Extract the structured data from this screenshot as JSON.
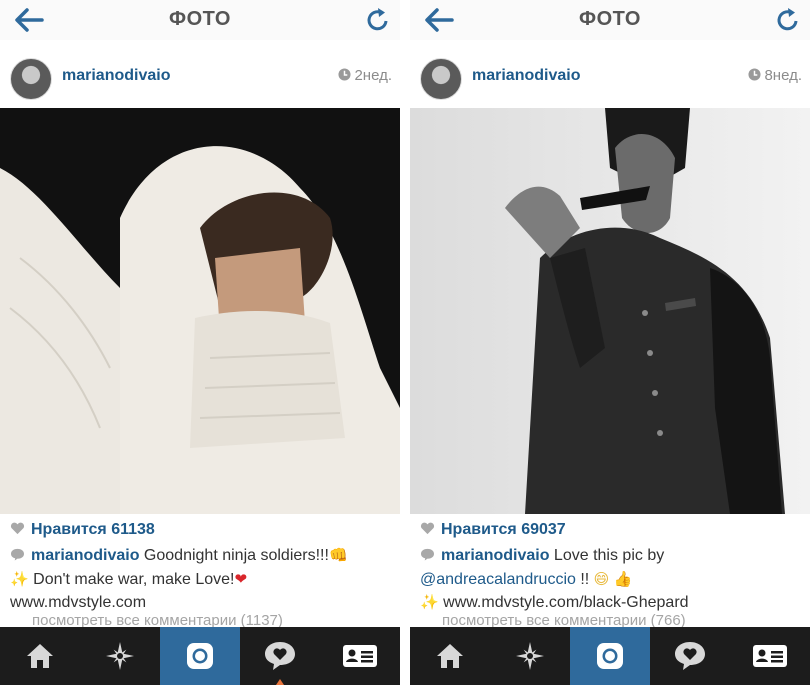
{
  "panels": [
    {
      "header": {
        "title": "ФОТО"
      },
      "post": {
        "username": "marianodivaio",
        "time": "2нед.",
        "likes": "Нравится 61138",
        "caption_user": "marianodivaio",
        "caption_text": " Goodnight ninja soldiers!!!",
        "caption_emoji_1": "👊",
        "caption_sparkle": "✨",
        "caption_text_2": " Don't make war, make Love!",
        "caption_emoji_2": "❤",
        "caption_link": "www.mdvstyle.com",
        "view_all_comments": "посмотреть все комментарии (1137)"
      }
    },
    {
      "header": {
        "title": "ФОТО"
      },
      "post": {
        "username": "marianodivaio",
        "time": "8нед.",
        "likes": "Нравится 69037",
        "caption_user": "marianodivaio",
        "caption_text": " Love this pic by",
        "caption_mention": "@andreacalandruccio",
        "caption_text_2": " !! ",
        "caption_emoji_1": "😄",
        "caption_emoji_2": "👍",
        "caption_sparkle": "✨",
        "caption_link": " www.mdvstyle.com/black-Ghepard",
        "view_all_comments": "посмотреть все комментарии (766)"
      }
    }
  ],
  "tabbar": {
    "tabs": [
      "home-icon",
      "explore-icon",
      "camera-icon",
      "activity-icon",
      "profile-icon"
    ],
    "active_index": 2
  },
  "colors": {
    "accent": "#1e5a8a",
    "tab_active": "#2f6a9c",
    "tabbar_bg": "#1c1c1c",
    "header_bg": "#fafafa"
  }
}
